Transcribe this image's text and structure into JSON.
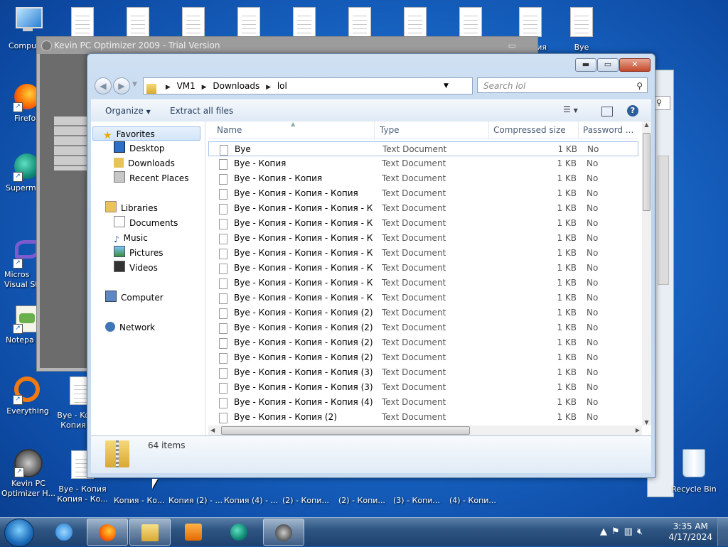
{
  "desktop": {
    "left_icons": [
      {
        "label": "Compu",
        "icon": "computer-icon"
      },
      {
        "label": "Firefo",
        "icon": "firefox-icon"
      },
      {
        "label": "Superm",
        "icon": "supermium-icon"
      },
      {
        "label": "Micros Visual St",
        "icon": "visual-studio-icon"
      },
      {
        "label": "Notepa",
        "icon": "notepad-icon"
      },
      {
        "label": "Everything",
        "icon": "everything-icon"
      },
      {
        "label": "Kevin PC Optimizer H...",
        "icon": "kevin-optimizer-icon"
      }
    ],
    "top_doc_labels": [
      "",
      "",
      "",
      "",
      "",
      "",
      "",
      "",
      "",
      "пия",
      "Bye"
    ],
    "col2_labels": [
      "Bye - Ko Копия",
      "Bye - Копия Копия - Ко..."
    ],
    "bottom_labels": [
      "Копия - Ко...",
      "Копия (2) - ...",
      "Копия (4) - ...",
      "(2) - Копи...",
      "(2) - Копи...",
      "(3) - Копи...",
      "(4) - Копи..."
    ],
    "recycle_bin": "Recycle Bin"
  },
  "kevin_window": {
    "title": "Kevin PC Optimizer 2009 - Trial Version"
  },
  "explorer": {
    "breadcrumb": [
      "VM1",
      "Downloads",
      "lol"
    ],
    "search_placeholder": "Search lol",
    "toolbar": {
      "organize": "Organize",
      "extract": "Extract all files"
    },
    "nav": {
      "favorites": "Favorites",
      "desktop": "Desktop",
      "downloads": "Downloads",
      "recent": "Recent Places",
      "libraries": "Libraries",
      "documents": "Documents",
      "music": "Music",
      "pictures": "Pictures",
      "videos": "Videos",
      "computer": "Computer",
      "network": "Network"
    },
    "columns": {
      "name": "Name",
      "type": "Type",
      "size": "Compressed size",
      "password": "Password ..."
    },
    "files": [
      {
        "name": "Bye",
        "type": "Text Document",
        "size": "1 KB",
        "password": "No"
      },
      {
        "name": "Bye - Копия",
        "type": "Text Document",
        "size": "1 KB",
        "password": "No"
      },
      {
        "name": "Bye - Копия - Копия",
        "type": "Text Document",
        "size": "1 KB",
        "password": "No"
      },
      {
        "name": "Bye - Копия - Копия - Копия",
        "type": "Text Document",
        "size": "1 KB",
        "password": "No"
      },
      {
        "name": "Bye - Копия - Копия - Копия - Ко...",
        "type": "Text Document",
        "size": "1 KB",
        "password": "No"
      },
      {
        "name": "Bye - Копия - Копия - Копия - Ко...",
        "type": "Text Document",
        "size": "1 KB",
        "password": "No"
      },
      {
        "name": "Bye - Копия - Копия - Копия - Ко...",
        "type": "Text Document",
        "size": "1 KB",
        "password": "No"
      },
      {
        "name": "Bye - Копия - Копия - Копия - Ко...",
        "type": "Text Document",
        "size": "1 KB",
        "password": "No"
      },
      {
        "name": "Bye - Копия - Копия - Копия - Ко...",
        "type": "Text Document",
        "size": "1 KB",
        "password": "No"
      },
      {
        "name": "Bye - Копия - Копия - Копия - Ко...",
        "type": "Text Document",
        "size": "1 KB",
        "password": "No"
      },
      {
        "name": "Bye - Копия - Копия - Копия - Ко...",
        "type": "Text Document",
        "size": "1 KB",
        "password": "No"
      },
      {
        "name": "Bye - Копия - Копия - Копия (2)",
        "type": "Text Document",
        "size": "1 KB",
        "password": "No"
      },
      {
        "name": "Bye - Копия - Копия - Копия (2) - ...",
        "type": "Text Document",
        "size": "1 KB",
        "password": "No"
      },
      {
        "name": "Bye - Копия - Копия - Копия (2) - ...",
        "type": "Text Document",
        "size": "1 KB",
        "password": "No"
      },
      {
        "name": "Bye - Копия - Копия - Копия (2) - ...",
        "type": "Text Document",
        "size": "1 KB",
        "password": "No"
      },
      {
        "name": "Bye - Копия - Копия - Копия (3)",
        "type": "Text Document",
        "size": "1 KB",
        "password": "No"
      },
      {
        "name": "Bye - Копия - Копия - Копия (3) - ...",
        "type": "Text Document",
        "size": "1 KB",
        "password": "No"
      },
      {
        "name": "Bye - Копия - Копия - Копия (4)",
        "type": "Text Document",
        "size": "1 KB",
        "password": "No"
      },
      {
        "name": "Bye - Копия - Копия (2)",
        "type": "Text Document",
        "size": "1 KB",
        "password": "No"
      }
    ],
    "item_count": "64 items"
  },
  "taskbar": {
    "time": "3:35 AM",
    "date": "4/17/2024"
  },
  "colors": {
    "accent": "#1e395b",
    "desktop": "#1865c4"
  }
}
